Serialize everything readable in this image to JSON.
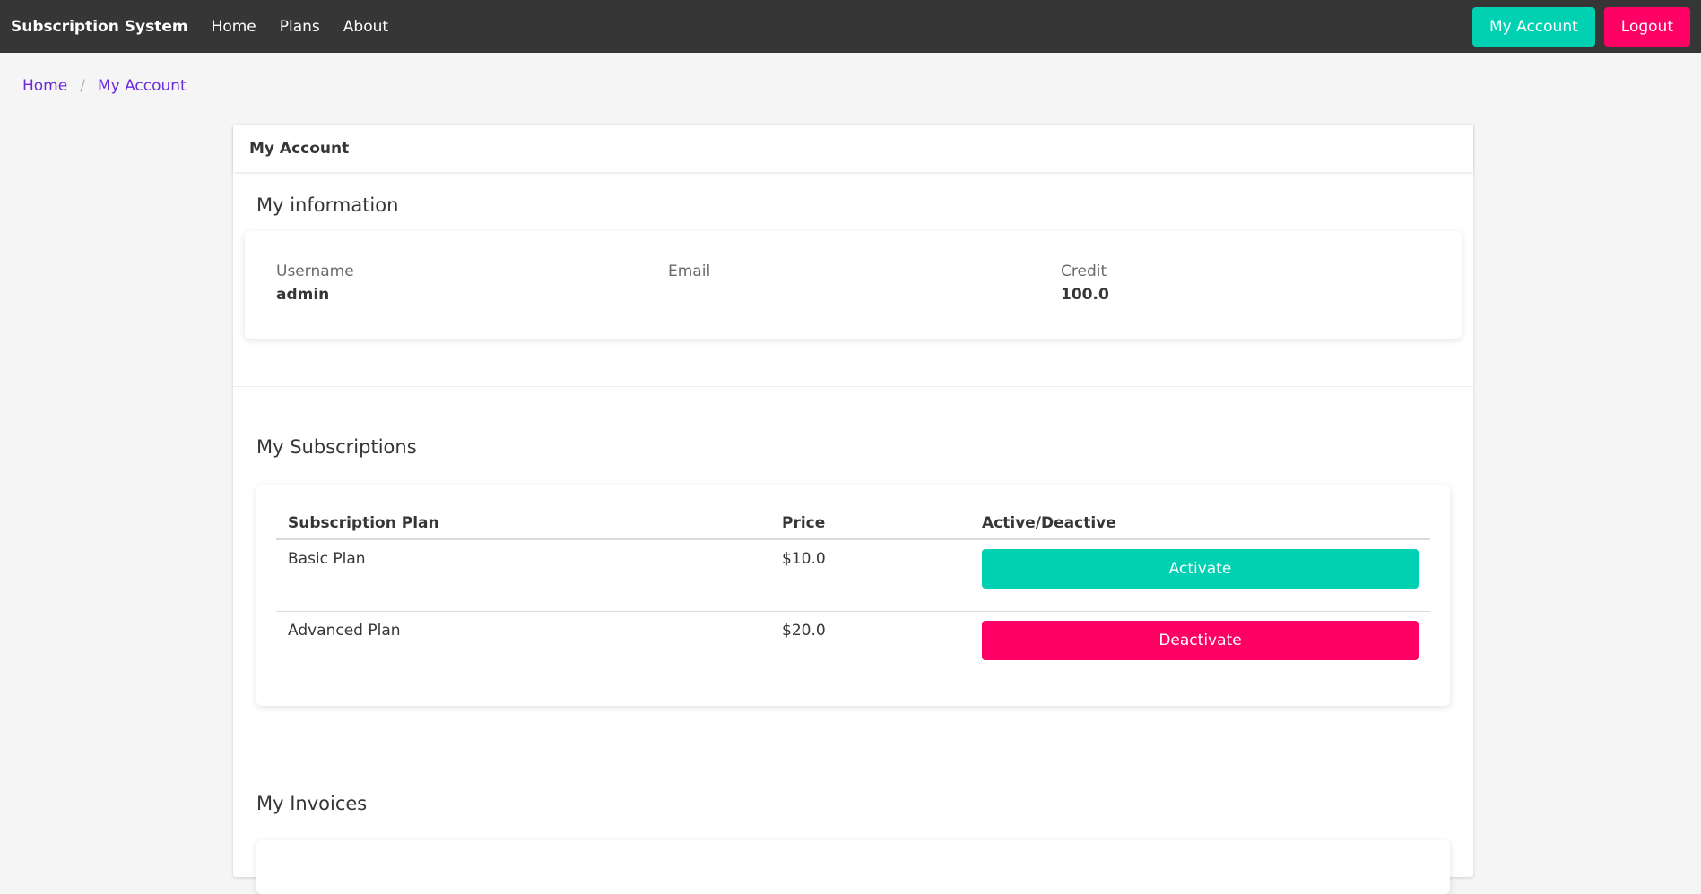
{
  "navbar": {
    "brand": "Subscription System",
    "links": [
      "Home",
      "Plans",
      "About"
    ],
    "my_account_label": "My Account",
    "logout_label": "Logout"
  },
  "breadcrumb": {
    "items": [
      "Home",
      "My Account"
    ],
    "separator": "/"
  },
  "card": {
    "header": "My Account",
    "info_title": "My information",
    "info": {
      "username_label": "Username",
      "username_value": "admin",
      "email_label": "Email",
      "email_value": "",
      "credit_label": "Credit",
      "credit_value": "100.0"
    },
    "subscriptions_title": "My Subscriptions",
    "subscriptions_table": {
      "headers": [
        "Subscription Plan",
        "Price",
        "Active/Deactive"
      ],
      "rows": [
        {
          "plan": "Basic Plan",
          "price": "$10.0",
          "action": "Activate",
          "action_color": "#00d1b2"
        },
        {
          "plan": "Advanced Plan",
          "price": "$20.0",
          "action": "Deactivate",
          "action_color": "#ff0065"
        }
      ]
    },
    "invoices_title": "My Invoices"
  },
  "colors": {
    "navbar_bg": "#363636",
    "primary": "#00d1b2",
    "danger": "#ff0065",
    "link": "#6b2bd9"
  }
}
